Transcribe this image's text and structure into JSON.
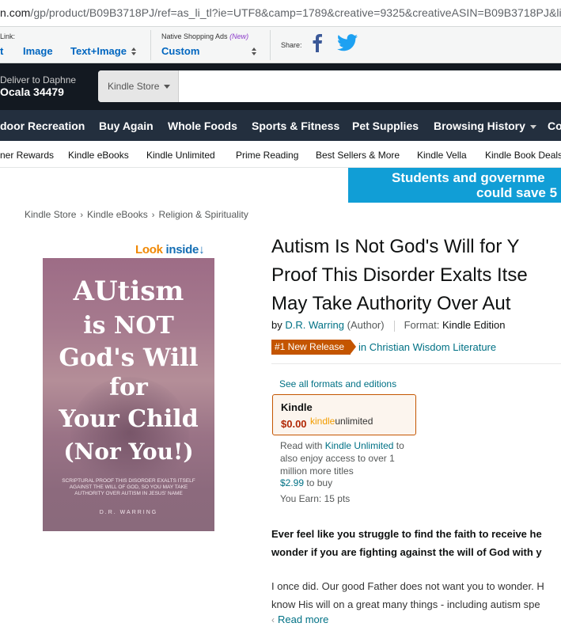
{
  "browser": {
    "url_host": "n.com",
    "url_path": "/gp/product/B09B3718PJ/ref=as_li_tl?ie=UTF8&camp=1789&creative=9325&creativeASIN=B09B3718PJ&link"
  },
  "sitestripe": {
    "link_label": "Link:",
    "opt_text": "t",
    "opt_image": "Image",
    "opt_text_image": "Text+Image",
    "native_label": "Native Shopping Ads",
    "native_new": "(New)",
    "native_value": "Custom",
    "share_label": "Share:",
    "share_icons": [
      "facebook-icon",
      "twitter-icon"
    ]
  },
  "header": {
    "deliver_line1": "Deliver to Daphne",
    "deliver_line2": "Ocala 34479",
    "search_dept": "Kindle Store"
  },
  "main_nav": [
    "door Recreation",
    "Buy Again",
    "Whole Foods",
    "Sports & Fitness",
    "Pet Supplies",
    "Browsing History",
    "Co"
  ],
  "sub_nav": [
    "ner Rewards",
    "Kindle eBooks",
    "Kindle Unlimited",
    "Prime Reading",
    "Best Sellers & More",
    "Kindle Vella",
    "Kindle Book Deals"
  ],
  "promo": {
    "line1": "Students and governme",
    "line2": "could save 5"
  },
  "breadcrumb": [
    "Kindle Store",
    "Kindle eBooks",
    "Religion & Spirituality"
  ],
  "cover": {
    "look": "Look",
    "inside": "inside",
    "arrow": "↓",
    "lines": [
      "AUtism",
      "is NOT",
      "God's Will",
      "for",
      "Your Child",
      "(Nor You!)"
    ],
    "subtitle": "SCRIPTURAL PROOF THIS DISORDER EXALTS ITSELF AGAINST THE WILL OF GOD, SO YOU MAY TAKE AUTHORITY OVER AUTISM IN JESUS' NAME",
    "author": "D.R. WARRING"
  },
  "product": {
    "title_lines": [
      "Autism Is Not God's Will for Y",
      "Proof This Disorder Exalts Itse",
      "May Take Authority Over Aut"
    ],
    "by": "by",
    "author": "D.R. Warring",
    "author_role": "(Author)",
    "format_label": "Format:",
    "format_value": "Kindle Edition",
    "badge": "#1 New Release",
    "badge_category": "in Christian Wisdom Literature",
    "all_formats": "See all formats and editions",
    "format_box": {
      "name": "Kindle",
      "price": "$0.00",
      "ku_kindle": "kindle",
      "ku_unlimited": "unlimited"
    },
    "read_with": "Read with",
    "ku_link": "Kindle Unlimited",
    "ku_desc": "to also enjoy access to over 1 million more titles",
    "buy_price": "$2.99",
    "buy_suffix": "to buy",
    "earn": "You Earn: 15 pts"
  },
  "description": {
    "bold_lines": [
      "Ever feel like you struggle to find the faith to receive he",
      "wonder if you are fighting against the will of God with y"
    ],
    "lines": [
      "I once did. Our good Father does not want you to wonder. H",
      "know His will on a great many things - including autism spe"
    ],
    "read_more": "Read more"
  }
}
